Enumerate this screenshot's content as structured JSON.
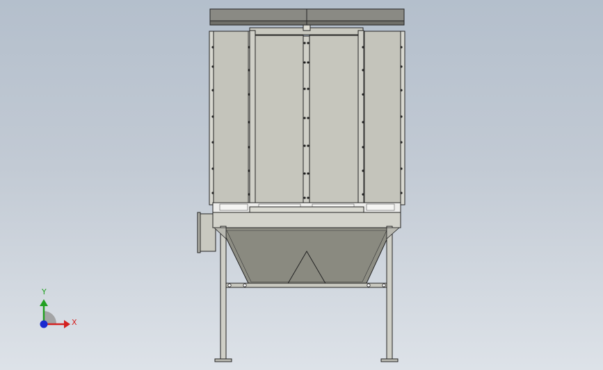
{
  "viewport": {
    "background_top": "#b4bfcc",
    "background_bottom": "#dde2e8"
  },
  "model": {
    "name": "dust-collector",
    "panel_color": "#c4c4bb",
    "hopper_color": "#8e8e84",
    "edge_color": "#222222"
  },
  "triad": {
    "x_label": "X",
    "y_label": "Y",
    "x_color": "#d42020",
    "y_color": "#22a022",
    "z_color": "#1a2ad0"
  }
}
